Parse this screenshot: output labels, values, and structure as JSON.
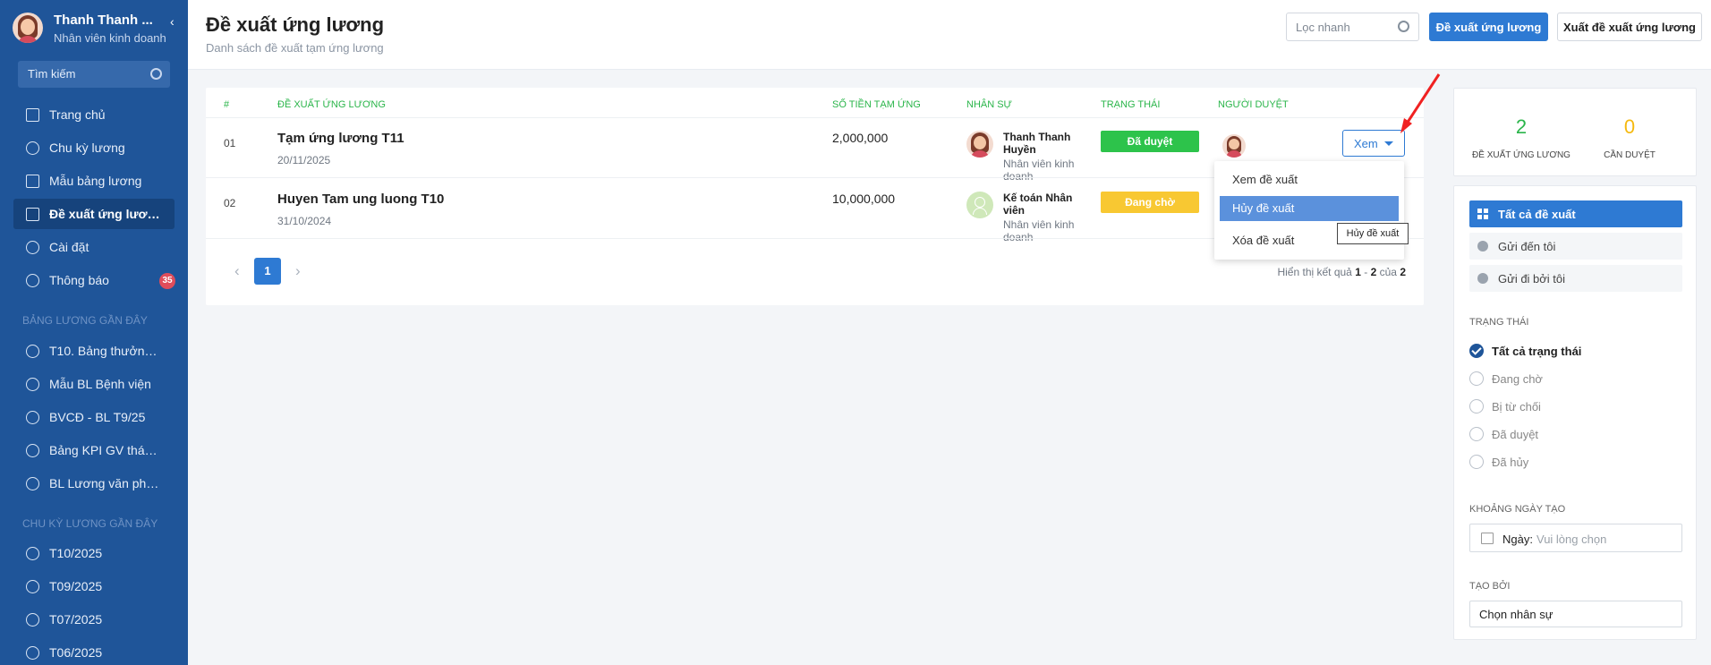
{
  "user": {
    "name": "Thanh Thanh ...",
    "role": "Nhân viên kinh doanh"
  },
  "sidebar": {
    "search_placeholder": "Tìm kiếm",
    "nav": [
      {
        "label": "Trang chủ",
        "icon": "home-icon"
      },
      {
        "label": "Chu kỳ lương",
        "icon": "cycle-icon"
      },
      {
        "label": "Mẫu bảng lương",
        "icon": "table-icon"
      },
      {
        "label": "Đề xuất ứng lương",
        "icon": "document-icon",
        "active": true
      },
      {
        "label": "Cài đặt",
        "icon": "gear-icon"
      },
      {
        "label": "Thông báo",
        "icon": "bell-icon",
        "badge": "35"
      }
    ],
    "recent_payroll_title": "BẢNG LƯƠNG GẦN ĐÂY",
    "recent_payroll": [
      "T10. Bảng thưởng ...",
      "Mẫu BL Bệnh viện",
      "BVCĐ - BL T9/25",
      "Bảng KPI GV tháng...",
      "BL Lương văn phòng"
    ],
    "recent_cycle_title": "CHU KỲ LƯƠNG GẦN ĐÂY",
    "recent_cycles": [
      "T10/2025",
      "T09/2025",
      "T07/2025",
      "T06/2025"
    ]
  },
  "header": {
    "title": "Đề xuất ứng lương",
    "subtitle": "Danh sách đề xuất tạm ứng lương",
    "quick_filter_placeholder": "Lọc nhanh",
    "create_button": "Đề xuất ứng lương",
    "export_button": "Xuất đề xuất ứng lương"
  },
  "table": {
    "columns": [
      "#",
      "ĐỀ XUẤT ỨNG LƯƠNG",
      "SỐ TIỀN TẠM ỨNG",
      "NHÂN SỰ",
      "TRẠNG THÁI",
      "NGƯỜI DUYỆT"
    ],
    "rows": [
      {
        "index": "01",
        "title": "Tạm ứng lương T11",
        "date": "20/11/2025",
        "amount": "2,000,000",
        "employee_name": "Thanh Thanh Huyền",
        "employee_role": "Nhân viên kinh doanh",
        "status": "Đã duyệt",
        "status_color": "#2dc34b",
        "action": "Xem"
      },
      {
        "index": "02",
        "title": "Huyen Tam ung luong T10",
        "date": "31/10/2024",
        "amount": "10,000,000",
        "employee_name": "Kế toán Nhân viên",
        "employee_role": "Nhân viên kinh doanh",
        "status": "Đang chờ",
        "status_color": "#f8c832"
      }
    ],
    "page": "1",
    "result_prefix": "Hiển thị kết quả",
    "result_from": "1",
    "result_sep": "-",
    "result_to": "2",
    "result_of": "của",
    "result_total": "2"
  },
  "dropdown": {
    "items": [
      "Xem đề xuất",
      "Hủy đề xuất",
      "Xóa đề xuất"
    ],
    "highlighted": "Hủy đề xuất",
    "tooltip": "Hủy đề xuất"
  },
  "stats": [
    {
      "value": "2",
      "label": "ĐỀ XUẤT ỨNG LƯƠNG",
      "color": "#2ab54a"
    },
    {
      "value": "0",
      "label": "CẦN DUYỆT",
      "color": "#f5b90f"
    }
  ],
  "filters": {
    "scope": [
      "Tất cả đề xuất",
      "Gửi đến tôi",
      "Gửi đi bởi tôi"
    ],
    "status_title": "TRẠNG THÁI",
    "statuses": [
      "Tất cả trạng thái",
      "Đang chờ",
      "Bị từ chối",
      "Đã duyệt",
      "Đã hủy"
    ],
    "date_title": "KHOẢNG NGÀY TẠO",
    "date_label": "Ngày:",
    "date_placeholder": "Vui lòng chọn",
    "created_by_title": "TẠO BỞI",
    "created_by_value": "Chọn nhân sự"
  },
  "colors": {
    "sidebar": "#1f5599",
    "accent": "#2e7ad3",
    "header_green": "#2ab54a"
  }
}
